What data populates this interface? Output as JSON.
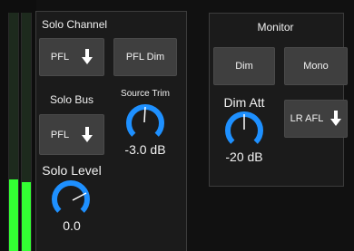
{
  "meters": {
    "left_level": 0.3,
    "right_level": 0.29,
    "fill_color": "#33ff33"
  },
  "solo_channel": {
    "title": "Solo Channel",
    "pfl_label": "PFL",
    "pfl_dim_label": "PFL Dim",
    "solo_bus_label": "Solo Bus",
    "solo_bus_value": "PFL",
    "source_trim_label": "Source Trim",
    "source_trim_value": "-3.0 dB",
    "solo_level_label": "Solo Level",
    "solo_level_value": "0.0"
  },
  "monitor": {
    "title": "Monitor",
    "dim_label": "Dim",
    "mono_label": "Mono",
    "dim_att_label": "Dim Att",
    "dim_att_value": "-20 dB",
    "lr_afl_label": "LR AFL"
  },
  "colors": {
    "knob_arc": "#1e90ff",
    "background": "#111111",
    "button": "#3f3f3f"
  },
  "icons": {
    "dropdown": "down-arrow-icon",
    "knob": "rotary-knob-icon"
  }
}
